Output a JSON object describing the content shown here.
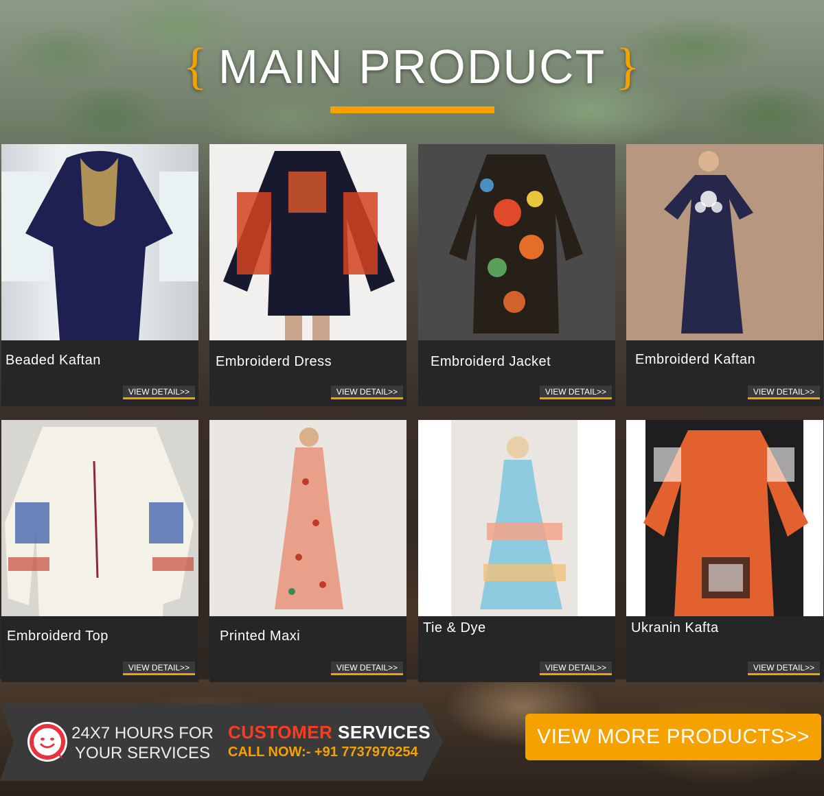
{
  "section": {
    "brace_open": "{",
    "title": "MAIN PRODUCT",
    "brace_close": "}"
  },
  "products": [
    {
      "name": "Beaded Kaftan",
      "button": "VIEW DETAIL>>"
    },
    {
      "name": "Embroiderd Dress",
      "button": "VIEW DETAIL>>"
    },
    {
      "name": "Embroiderd Jacket",
      "button": "VIEW DETAIL>>"
    },
    {
      "name": "Embroiderd Kaftan",
      "button": "VIEW DETAIL>>"
    },
    {
      "name": "Embroiderd Top",
      "button": "VIEW DETAIL>>"
    },
    {
      "name": "Printed Maxi",
      "button": "VIEW DETAIL>>"
    },
    {
      "name": "Tie & Dye",
      "button": "VIEW DETAIL>>"
    },
    {
      "name": "Ukranin Kafta",
      "button": "VIEW DETAIL>>"
    }
  ],
  "support": {
    "hours_line1": "24X7 HOURS FOR",
    "hours_line2": "YOUR SERVICES",
    "title_part1": "CUSTOMER",
    "title_part2": "SERVICES",
    "call_label": "CALL NOW:-",
    "phone": "+91 7737976254",
    "icon": "smiley-chat-icon"
  },
  "cta": {
    "label": "VIEW MORE PRODUCTS>>"
  },
  "colors": {
    "accent": "#f5a200",
    "red": "#ff3b1f",
    "card_bg": "#262626"
  }
}
